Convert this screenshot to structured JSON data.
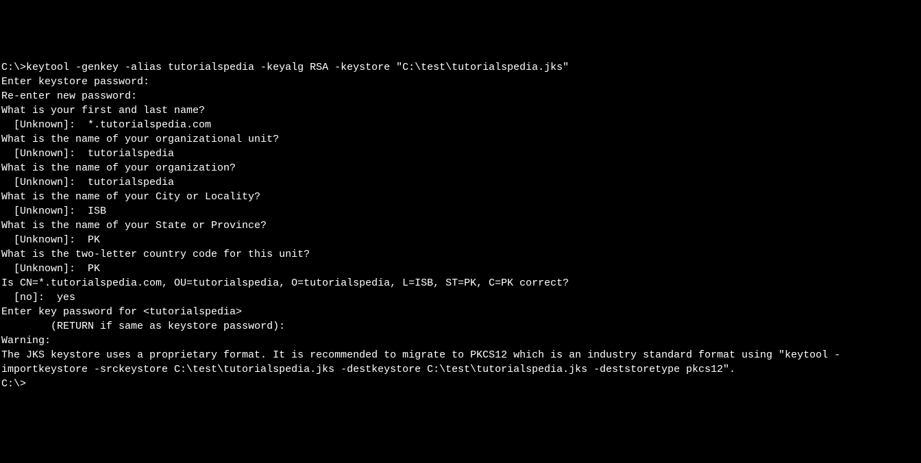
{
  "terminal": {
    "lines": [
      "C:\\>keytool -genkey -alias tutorialspedia -keyalg RSA -keystore \"C:\\test\\tutorialspedia.jks\"",
      "Enter keystore password:",
      "Re-enter new password:",
      "What is your first and last name?",
      "  [Unknown]:  *.tutorialspedia.com",
      "What is the name of your organizational unit?",
      "  [Unknown]:  tutorialspedia",
      "What is the name of your organization?",
      "  [Unknown]:  tutorialspedia",
      "What is the name of your City or Locality?",
      "  [Unknown]:  ISB",
      "What is the name of your State or Province?",
      "  [Unknown]:  PK",
      "What is the two-letter country code for this unit?",
      "  [Unknown]:  PK",
      "Is CN=*.tutorialspedia.com, OU=tutorialspedia, O=tutorialspedia, L=ISB, ST=PK, C=PK correct?",
      "  [no]:  yes",
      "",
      "Enter key password for <tutorialspedia>",
      "        (RETURN if same as keystore password):",
      "",
      "Warning:",
      "The JKS keystore uses a proprietary format. It is recommended to migrate to PKCS12 which is an industry standard format using \"keytool -importkeystore -srckeystore C:\\test\\tutorialspedia.jks -destkeystore C:\\test\\tutorialspedia.jks -deststoretype pkcs12\".",
      "",
      "C:\\>"
    ]
  }
}
